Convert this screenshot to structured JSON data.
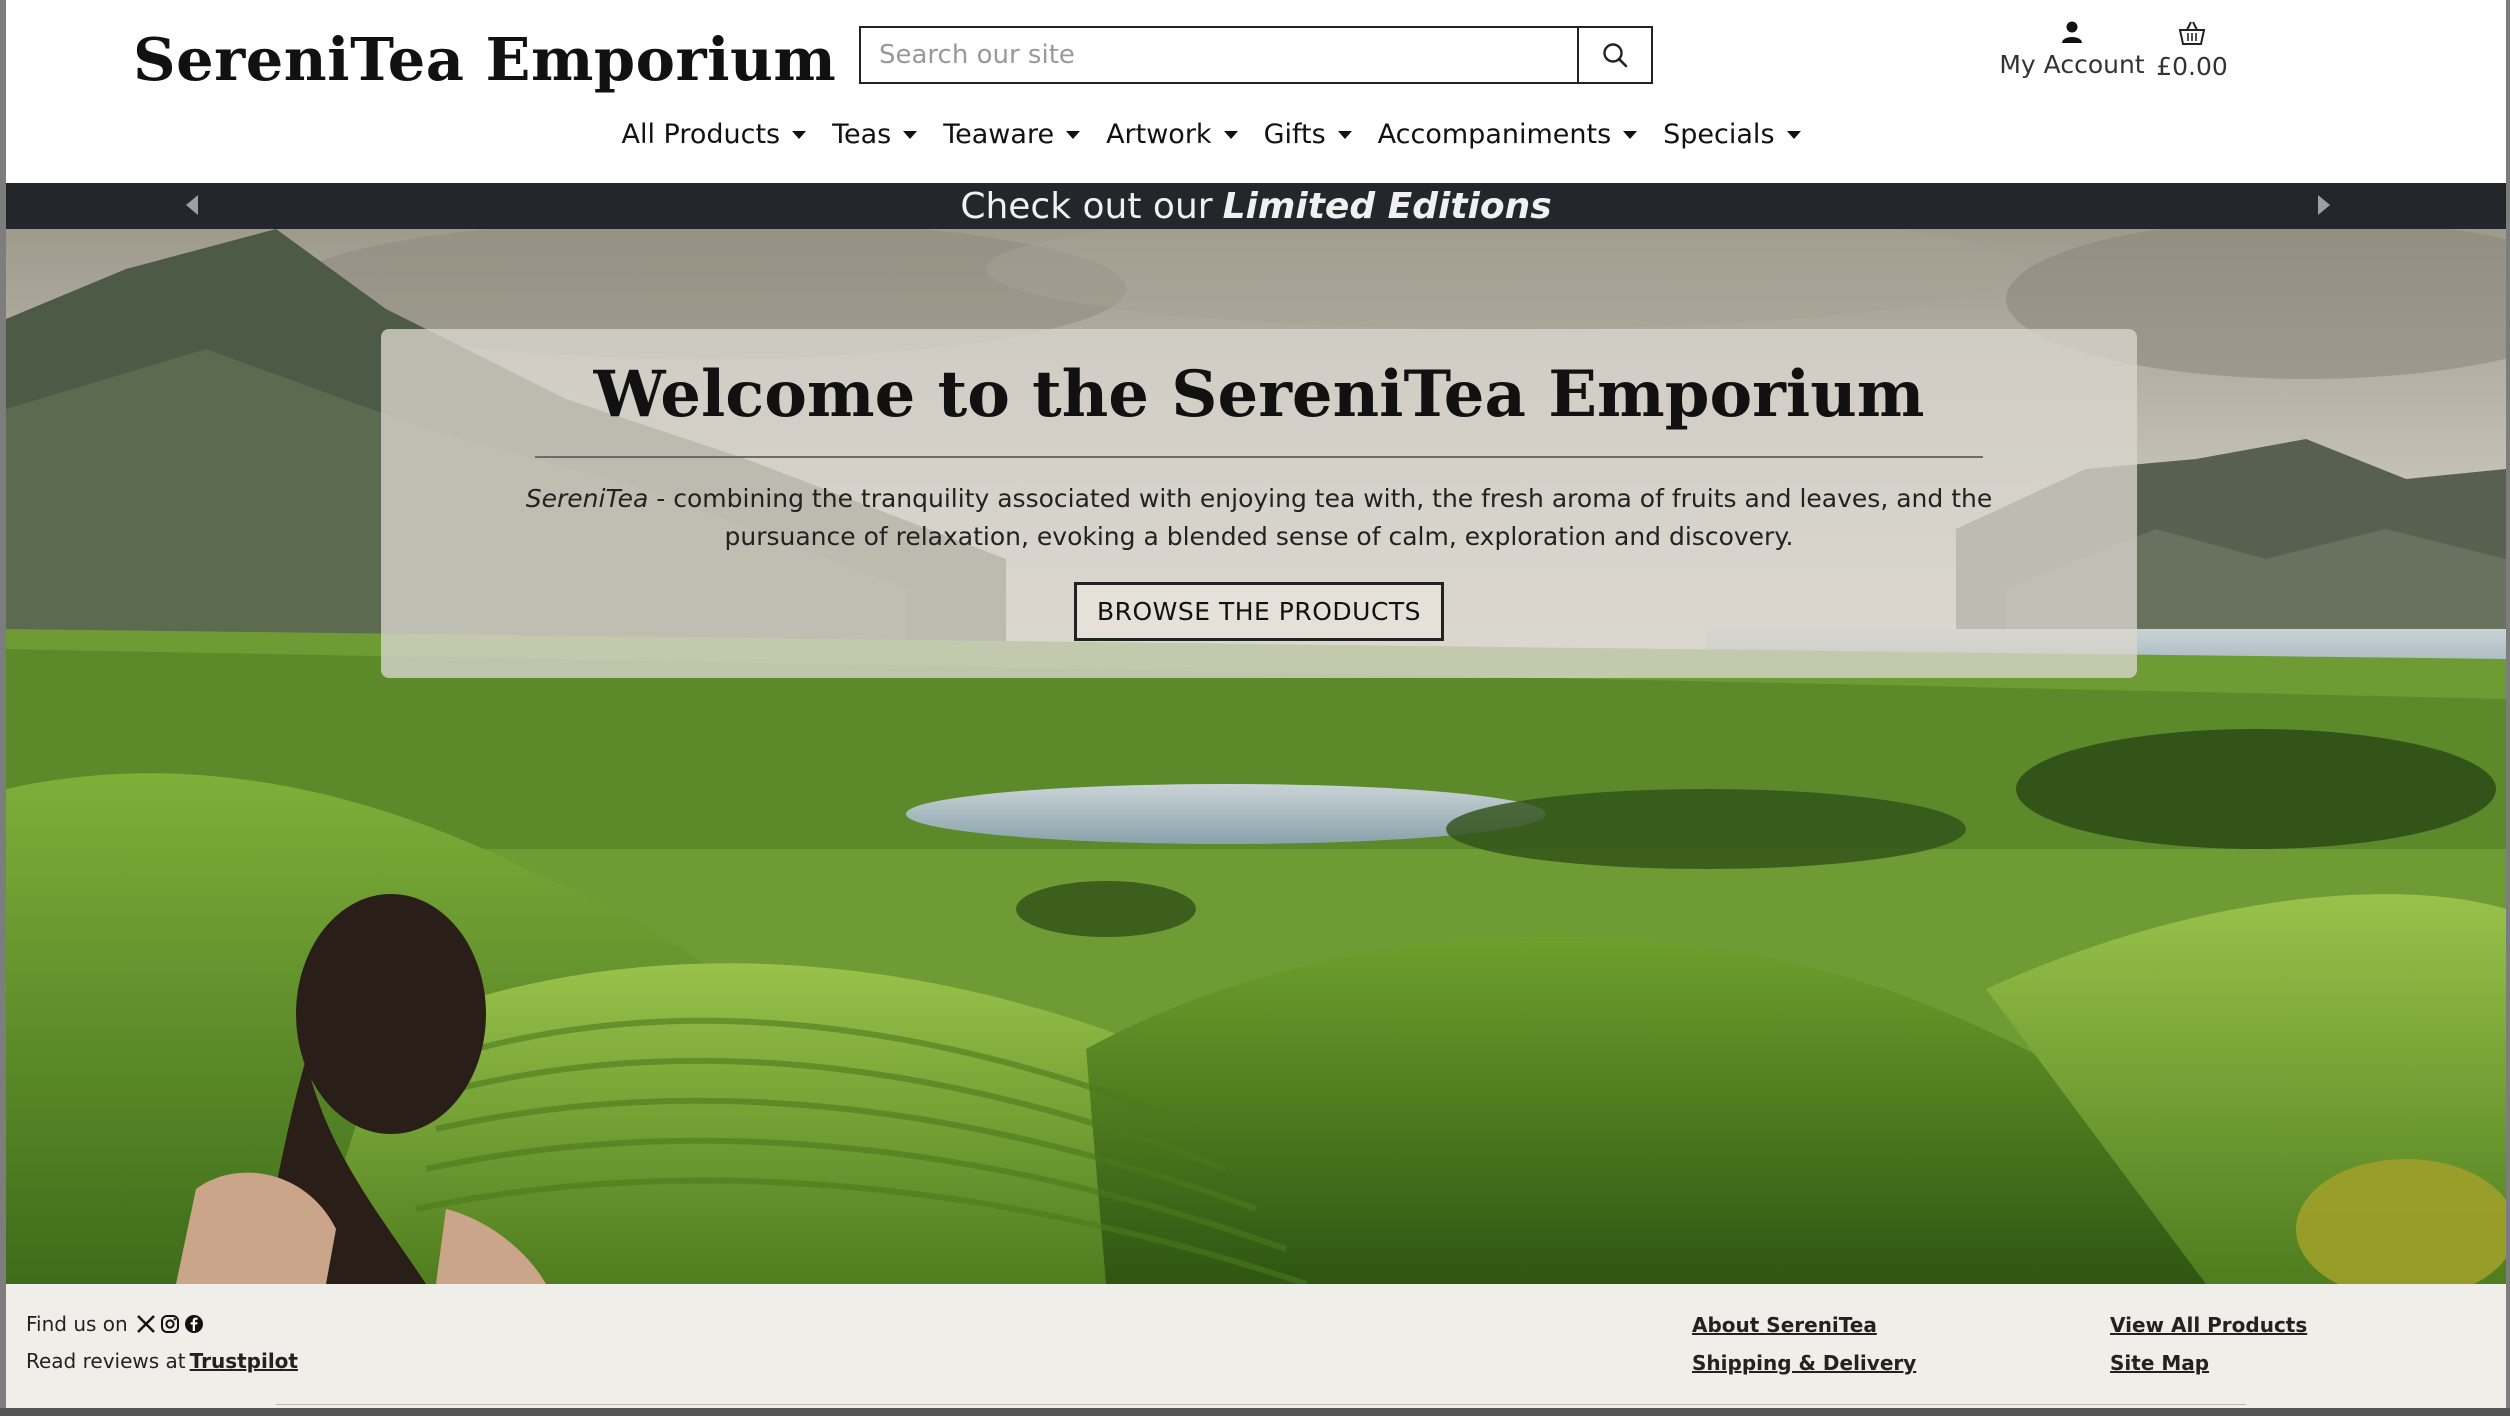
{
  "header": {
    "logo": "SereniTea Emporium",
    "search_placeholder": "Search our site",
    "account_label": "My Account",
    "basket_total": "£0.00"
  },
  "nav": {
    "items": [
      {
        "label": "All Products"
      },
      {
        "label": "Teas"
      },
      {
        "label": "Teaware"
      },
      {
        "label": "Artwork"
      },
      {
        "label": "Gifts"
      },
      {
        "label": "Accompaniments"
      },
      {
        "label": "Specials"
      }
    ]
  },
  "banner": {
    "text_prefix": "Check out our",
    "text_emphasis": "Limited Editions"
  },
  "hero": {
    "title": "Welcome to the SereniTea Emporium",
    "intro_brand": "SereniTea",
    "intro_text": " - combining the tranquility associated with enjoying tea with, the fresh aroma of fruits and leaves, and the pursuance of relaxation, evoking a blended sense of calm, exploration and discovery.",
    "button_label": "BROWSE THE PRODUCTS"
  },
  "footer": {
    "find_us_label": "Find us on",
    "reviews_label": "Read reviews at",
    "trustpilot_link": "Trustpilot",
    "links_col1": [
      "About SereniTea",
      "Shipping & Delivery"
    ],
    "links_col2": [
      "View All Products",
      "Site Map"
    ],
    "social_icons": [
      "x-icon",
      "instagram-icon",
      "facebook-icon"
    ]
  },
  "colors": {
    "banner_bg": "#23262b",
    "footer_bg": "#f0eee9",
    "hero_panel": "#dad6ce"
  }
}
